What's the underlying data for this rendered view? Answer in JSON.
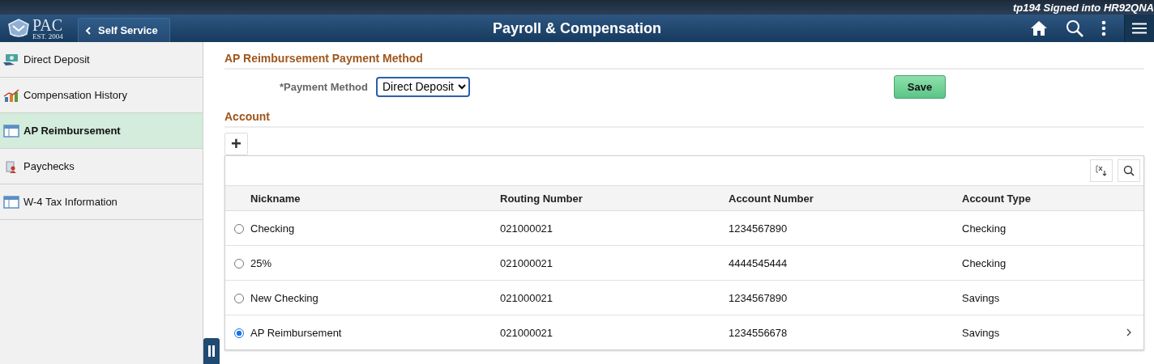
{
  "header": {
    "signed_in": "tp194 Signed into HR92QNA",
    "logo": {
      "name": "PAC",
      "est": "EST. 2004"
    },
    "back_button": "Self Service",
    "title": "Payroll & Compensation"
  },
  "sidebar": {
    "items": [
      {
        "label": "Direct Deposit",
        "selected": false
      },
      {
        "label": "Compensation History",
        "selected": false
      },
      {
        "label": "AP Reimbursement",
        "selected": true
      },
      {
        "label": "Paychecks",
        "selected": false
      },
      {
        "label": "W-4 Tax Information",
        "selected": false
      }
    ]
  },
  "payment_section": {
    "title": "AP Reimbursement Payment Method",
    "field_label": "*Payment Method",
    "payment_method": "Direct Deposit",
    "save_button": "Save"
  },
  "account_section": {
    "title": "Account",
    "add_button": "+",
    "table": {
      "columns": [
        "Nickname",
        "Routing Number",
        "Account Number",
        "Account Type"
      ],
      "rows": [
        {
          "selected": false,
          "cells": [
            "Checking",
            "021000021",
            "1234567890",
            "Checking"
          ]
        },
        {
          "selected": false,
          "cells": [
            "25%",
            "021000021",
            "4444545444",
            "Checking"
          ]
        },
        {
          "selected": false,
          "cells": [
            "New Checking",
            "021000021",
            "1234567890",
            "Savings"
          ]
        },
        {
          "selected": true,
          "cells": [
            "AP Reimbursement",
            "021000021",
            "1234556678",
            "Savings"
          ]
        }
      ]
    }
  }
}
